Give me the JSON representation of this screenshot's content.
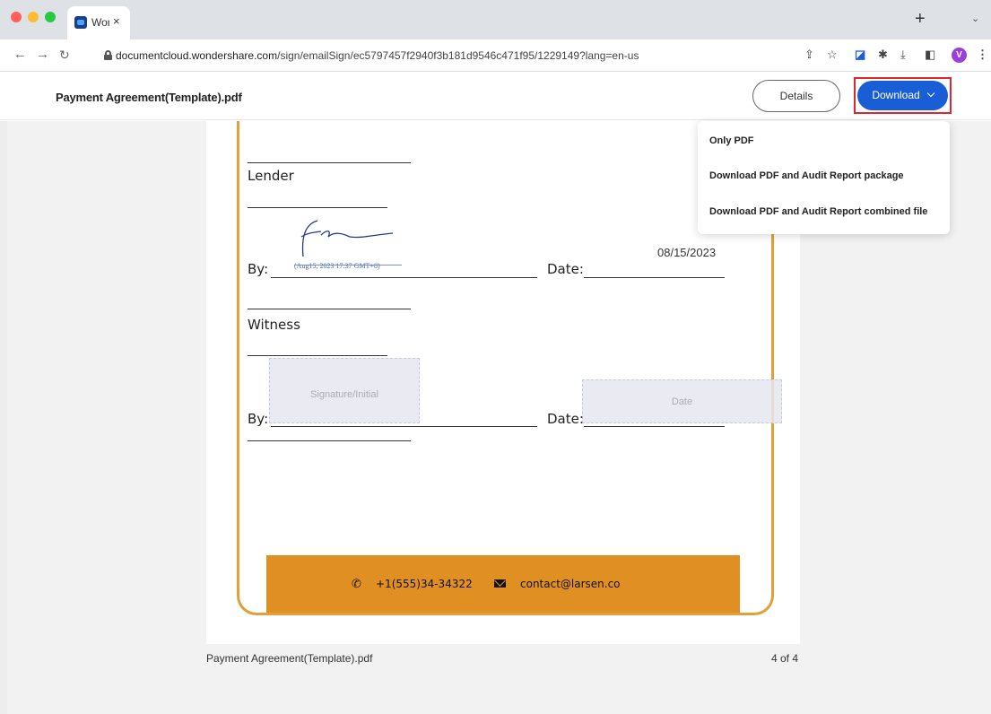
{
  "browser": {
    "tab_title": "Won",
    "tab_close": "×",
    "new_tab": "+",
    "tab_list": "⌄",
    "url_host": "documentcloud.wondershare.com",
    "url_path": "/sign/emailSign/ec5797457f2940f3b181d9546c471f95/1229149?lang=en-us",
    "profile_initial": "V",
    "icons": [
      "share-icon",
      "star-icon",
      "extension-icon",
      "puzzle-icon",
      "download-icon",
      "sidepanel-icon",
      "kebab-menu-icon"
    ]
  },
  "header": {
    "title": "Payment Agreement(Template).pdf",
    "details_label": "Details",
    "download_label": "Download"
  },
  "menu": {
    "items": [
      "Only PDF",
      "Download PDF and Audit Report package",
      "Download PDF and Audit Report combined file"
    ]
  },
  "document": {
    "lender_label": "Lender",
    "witness_label": "Witness",
    "by_label": "By:",
    "date_label": "Date:",
    "signature_stamp": "(Aug15, 2023 17:37 GMT+8)",
    "signed_date": "08/15/2023",
    "signature_placeholder": "Signature/Initial",
    "date_placeholder": "Date",
    "phone": "+1(555)34-34322",
    "email": "contact@larsen.co"
  },
  "footer": {
    "file_name": "Payment Agreement(Template).pdf",
    "page_indicator": "4 of 4"
  },
  "colors": {
    "accent": "#1a5ed6",
    "highlight_outline": "#e0262d",
    "doc_border": "#e0a03a",
    "doc_footer": "#e08f22"
  }
}
